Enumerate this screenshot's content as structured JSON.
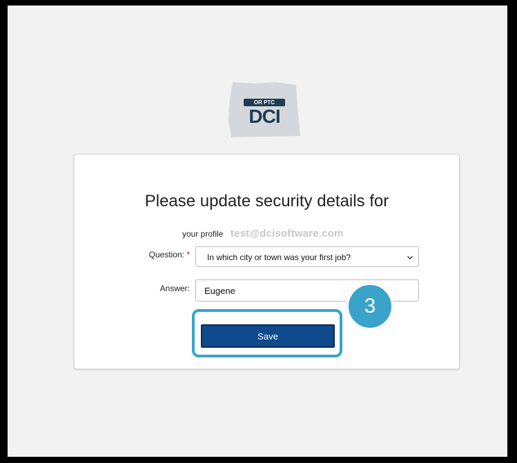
{
  "logo": {
    "small_text": "OR PTC",
    "big_text": "DCI"
  },
  "card": {
    "title": "Please update security details for",
    "profile_label": "your profile",
    "profile_email": "test@dcisoftware.com",
    "question": {
      "label": "Question:",
      "required_marker": "*",
      "selected": "In which city or town was your first job?"
    },
    "answer": {
      "label": "Answer:",
      "value": "Eugene"
    },
    "save_label": "Save"
  },
  "annotation": {
    "step_number": "3"
  },
  "colors": {
    "primary_button": "#104a8c",
    "highlight": "#3aa3c9",
    "required": "#c8102e"
  }
}
